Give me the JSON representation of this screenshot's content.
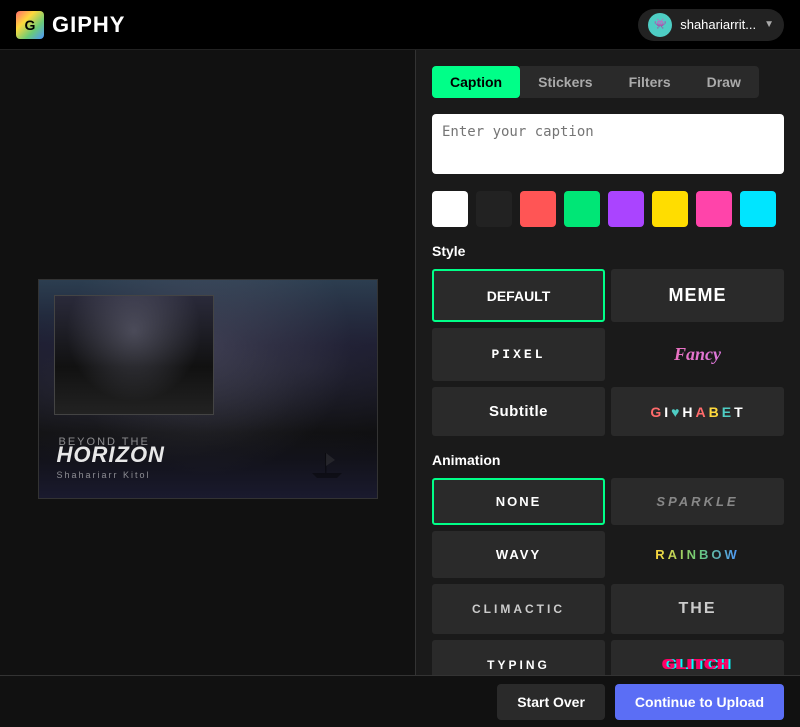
{
  "header": {
    "logo_text": "GIPHY",
    "user_name": "shahariarrit...",
    "user_avatar_emoji": "👾"
  },
  "tabs": [
    {
      "id": "caption",
      "label": "Caption",
      "active": true
    },
    {
      "id": "stickers",
      "label": "Stickers",
      "active": false
    },
    {
      "id": "filters",
      "label": "Filters",
      "active": false
    },
    {
      "id": "draw",
      "label": "Draw",
      "active": false
    }
  ],
  "caption": {
    "placeholder": "Enter your caption",
    "value": ""
  },
  "colors": [
    {
      "id": "white",
      "hex": "#ffffff"
    },
    {
      "id": "black",
      "hex": "#222222"
    },
    {
      "id": "red",
      "hex": "#ff5555"
    },
    {
      "id": "green",
      "hex": "#00e676"
    },
    {
      "id": "purple",
      "hex": "#aa44ff"
    },
    {
      "id": "yellow",
      "hex": "#ffdd00"
    },
    {
      "id": "pink",
      "hex": "#ff44aa"
    },
    {
      "id": "cyan",
      "hex": "#00e5ff"
    }
  ],
  "style": {
    "label": "Style",
    "options": [
      {
        "id": "default",
        "label": "DEFAULT",
        "active": true
      },
      {
        "id": "meme",
        "label": "MEME",
        "active": false
      },
      {
        "id": "pixel",
        "label": "PIXEL",
        "active": false
      },
      {
        "id": "fancy",
        "label": "Fancy",
        "active": false
      },
      {
        "id": "subtitle",
        "label": "Subtitle",
        "active": false
      },
      {
        "id": "alphabet",
        "label": "GIPHABET",
        "active": false
      }
    ]
  },
  "animation": {
    "label": "Animation",
    "options": [
      {
        "id": "none",
        "label": "NONE",
        "active": true
      },
      {
        "id": "sparkle",
        "label": "SPARKLE",
        "active": false
      },
      {
        "id": "wavy",
        "label": "WAvy",
        "active": false
      },
      {
        "id": "rainbow",
        "label": "RAINBOW",
        "active": false
      },
      {
        "id": "climactic",
        "label": "CLIMACTIC",
        "active": false
      },
      {
        "id": "the",
        "label": "THE",
        "active": false
      },
      {
        "id": "typing",
        "label": "TYPING",
        "active": false
      },
      {
        "id": "glitch",
        "label": "GLITCH",
        "active": false
      }
    ]
  },
  "footer": {
    "start_over_label": "Start Over",
    "continue_label": "Continue to Upload"
  },
  "preview": {
    "subtitle1": "BEYOND THE",
    "title": "HORIZON",
    "subtitle2": "Shahariarr Kitol"
  }
}
